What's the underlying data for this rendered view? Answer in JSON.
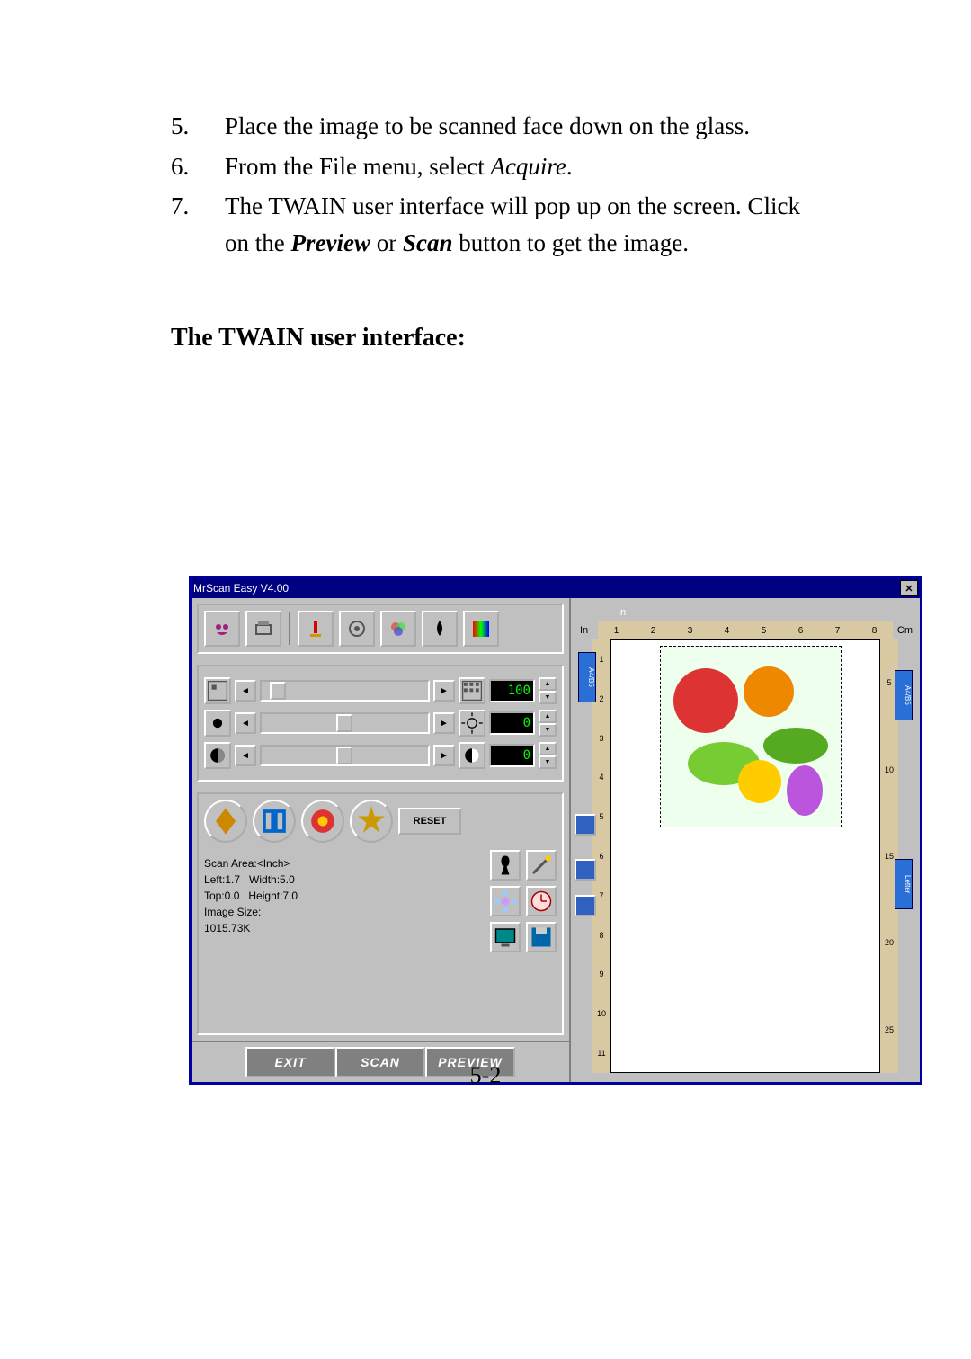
{
  "steps": [
    {
      "num": "5.",
      "text_plain": "Place the image to be scanned face down on the glass."
    },
    {
      "num": "6.",
      "text_prefix": "From the File menu, select ",
      "text_italic": "Acquire",
      "text_suffix": "."
    },
    {
      "num": "7.",
      "text_a": "The TWAIN user interface will pop up on the screen. Click on the ",
      "bold1": "Preview",
      "mid": " or ",
      "bold2": "Scan",
      "text_b": " button to get the image."
    }
  ],
  "heading": "The TWAIN user interface:",
  "page_number": "5-2",
  "twain": {
    "title": "MrScan Easy V4.00",
    "close_glyph": "✕",
    "sliders": {
      "resolution": {
        "value": "100"
      },
      "brightness": {
        "value": "0"
      },
      "contrast": {
        "value": "0"
      }
    },
    "reset_label": "RESET",
    "scan_area": {
      "heading": "Scan Area:<Inch>",
      "left_label": "Left:1.7",
      "width_label": "Width:5.0",
      "top_label": "Top:0.0",
      "height_label": "Height:7.0",
      "size_label": "Image Size:",
      "size_value": "1015.73K"
    },
    "bottom": {
      "exit": "EXIT",
      "scan": "SCAN",
      "preview": "PREVIEW"
    },
    "ruler": {
      "unit_in": "In",
      "unit_cm": "Cm",
      "top": [
        "1",
        "2",
        "3",
        "4",
        "5",
        "6",
        "7",
        "8"
      ],
      "left": [
        "1",
        "2",
        "3",
        "4",
        "5",
        "6",
        "7",
        "8",
        "9",
        "10",
        "11"
      ],
      "right": [
        "5",
        "10",
        "15",
        "20",
        "25"
      ]
    },
    "tags": {
      "a": "A4/B5",
      "b": "A4/B5",
      "c": "Letter"
    },
    "icons": {
      "owl": "owl-icon",
      "scanner": "scanner-icon",
      "type": "scan-type-icon",
      "gear1": "settings-icon",
      "gear2": "color-settings-icon",
      "drop": "droplet-icon",
      "grad": "gradient-icon",
      "res_l": "resolution-low-icon",
      "res_r": "resolution-high-icon",
      "bri_l": "brightness-low-icon",
      "bri_r": "brightness-high-icon",
      "con_l": "contrast-low-icon",
      "con_r": "contrast-high-icon",
      "invert": "invert-icon",
      "mirror": "mirror-icon",
      "descreen": "descreen-icon",
      "auto": "auto-icon",
      "head": "silhouette-icon",
      "wand": "magic-wand-icon",
      "flower": "flower-icon",
      "clock": "clock-icon",
      "monitor": "monitor-icon",
      "disk": "disk-icon",
      "zoom": "zoom-icon",
      "fit": "fit-icon",
      "rotate": "rotate-icon"
    }
  }
}
